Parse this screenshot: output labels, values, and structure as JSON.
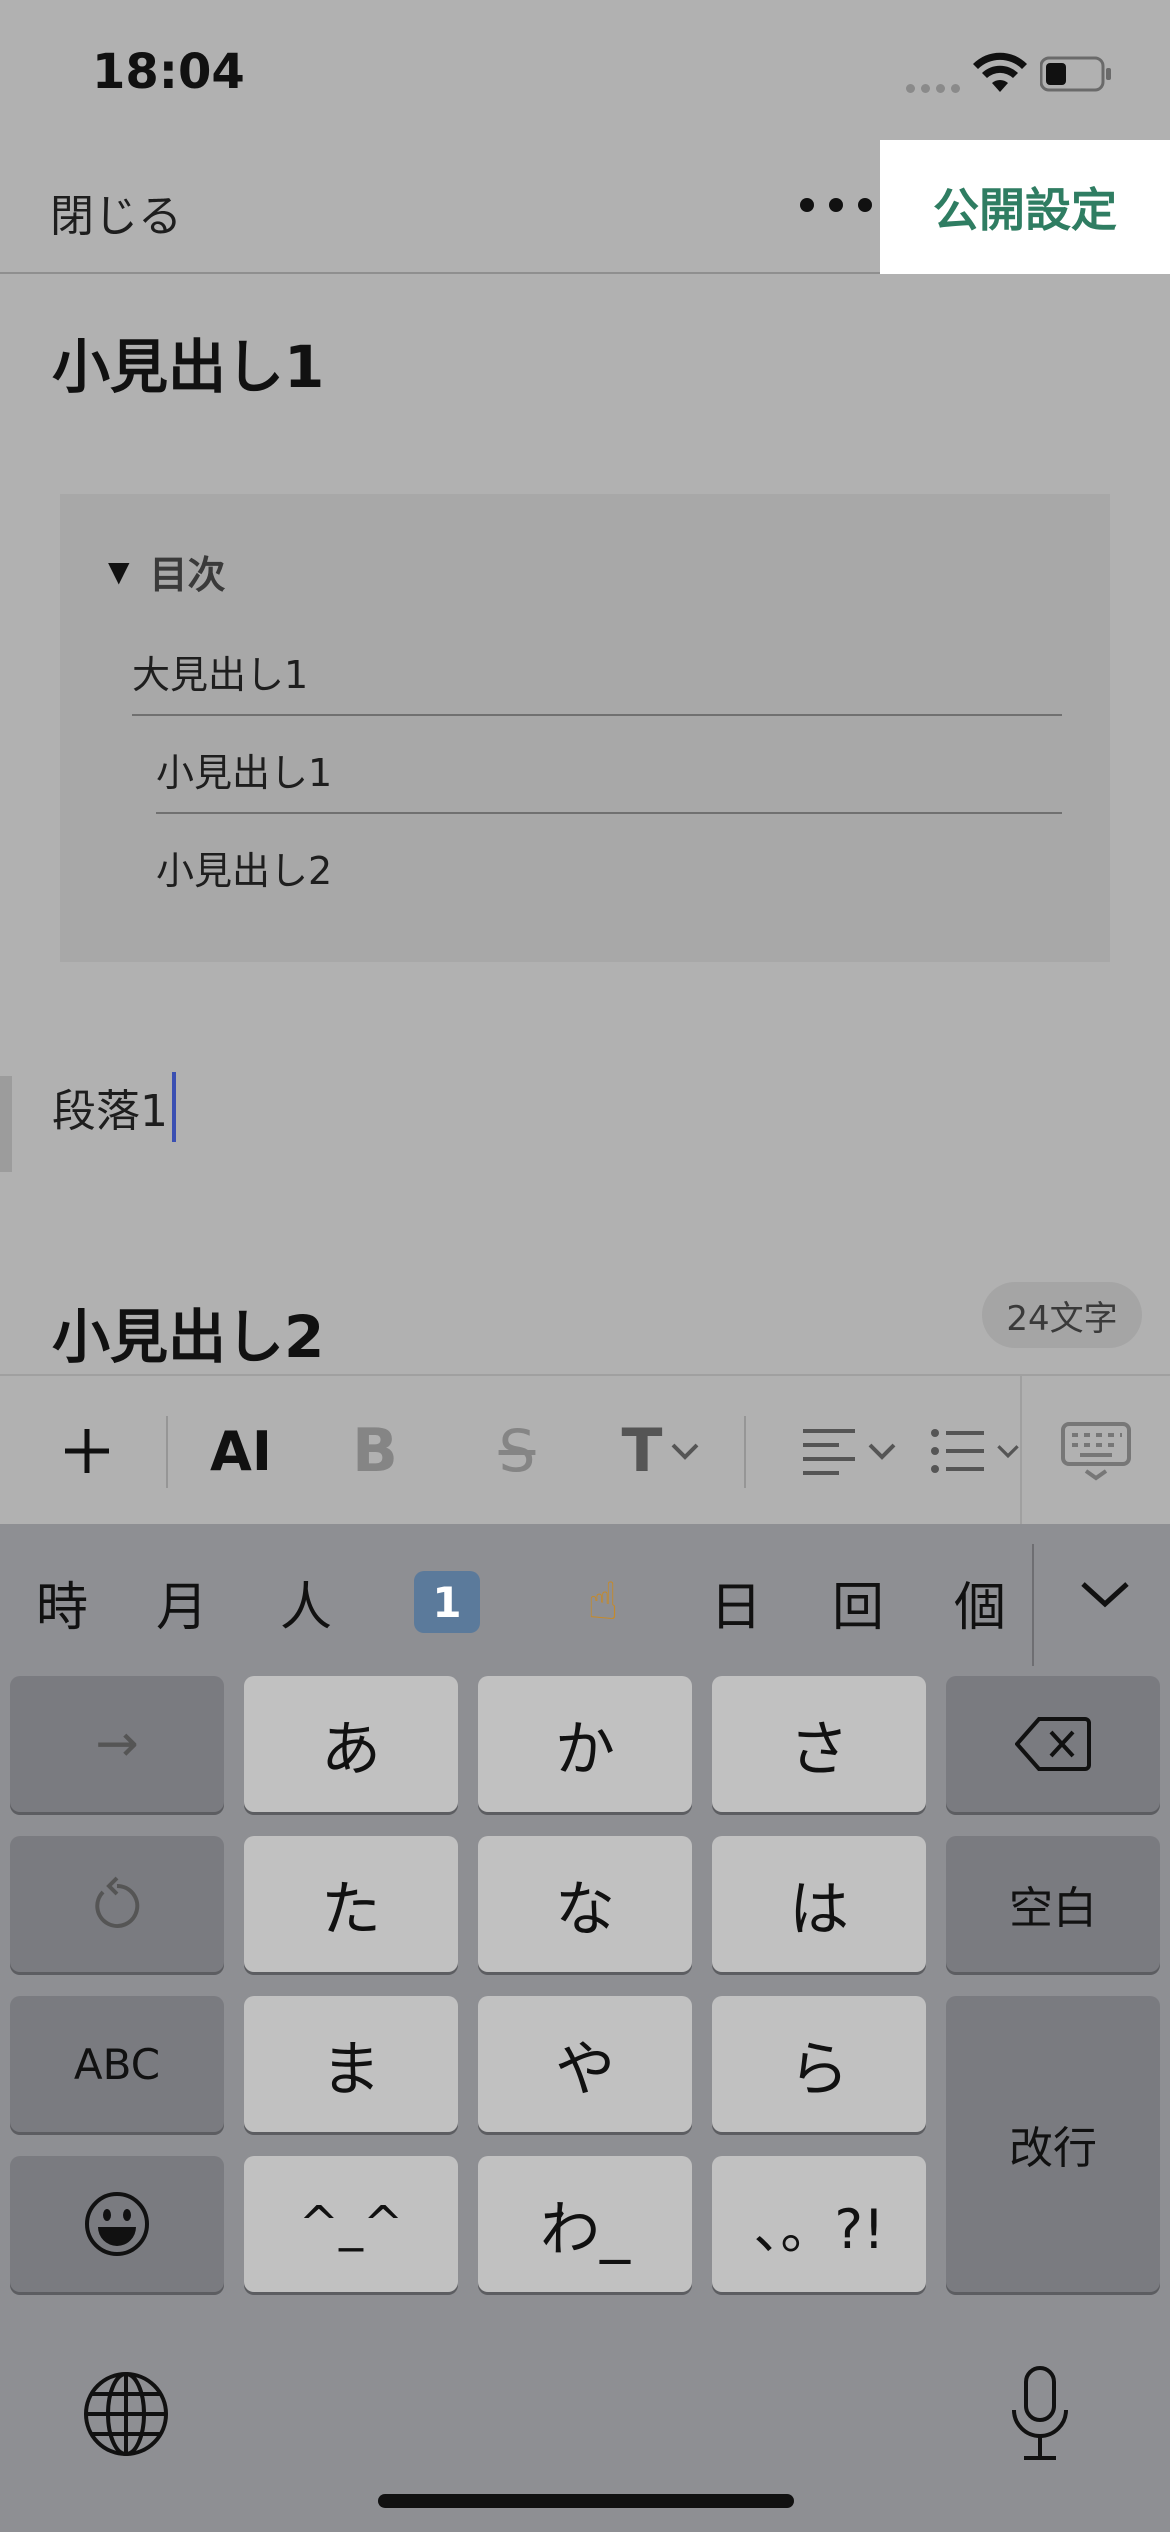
{
  "status_bar": {
    "time": "18:04"
  },
  "header": {
    "close_label": "閉じる",
    "publish_label": "公開設定"
  },
  "content": {
    "heading_1": "小見出し1",
    "toc": {
      "title": "目次",
      "items": [
        {
          "label": "大見出し1",
          "level": 1
        },
        {
          "label": "小見出し1",
          "level": 2
        },
        {
          "label": "小見出し2",
          "level": 2
        }
      ]
    },
    "paragraph": "段落1",
    "heading_2": "小見出し2",
    "char_count": "24文字"
  },
  "format_toolbar": {
    "ai_label": "AI",
    "bold_label": "B",
    "strike_label": "S",
    "text_style_label": "T"
  },
  "keyboard": {
    "candidates": [
      "時",
      "月",
      "人",
      "1",
      "☝",
      "日",
      "回",
      "個"
    ],
    "rows": [
      [
        "→",
        "あ",
        "か",
        "さ"
      ],
      [
        "た",
        "な",
        "は",
        "空白"
      ],
      [
        "ABC",
        "ま",
        "や",
        "ら",
        "改行"
      ],
      [
        "^_^",
        "わ_",
        "、。?!"
      ]
    ]
  },
  "colors": {
    "accent_green": "#2f7d62",
    "caret_blue": "#3a4fb2"
  }
}
